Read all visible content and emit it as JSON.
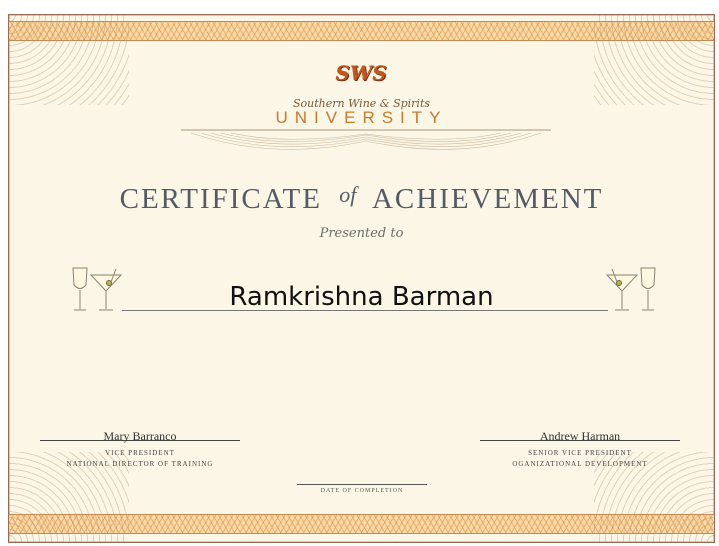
{
  "logo": {
    "monogram": "SWS",
    "subtitle": "Southern Wine & Spirits",
    "university": "UNIVERSITY"
  },
  "certificate": {
    "title_part1": "CERTIFICATE",
    "title_of": "of",
    "title_part2": "ACHIEVEMENT",
    "presented_to": "Presented to",
    "recipient": "Ramkrishna Barman",
    "date_label": "DATE OF COMPLETION"
  },
  "signatories": [
    {
      "name": "Mary Barranco",
      "role1": "VICE PRESIDENT",
      "role2": "NATIONAL DIRECTOR OF TRAINING"
    },
    {
      "name": "Andrew Harman",
      "role1": "SENIOR VICE PRESIDENT",
      "role2": "OGANIZATIONAL DEVELOPMENT"
    }
  ],
  "colors": {
    "background": "#fbf6e6",
    "border_band": "#f8d9a8",
    "accent": "#c57a2c",
    "title_text": "#555a66"
  },
  "icons": [
    "wine-glass-icon",
    "martini-glass-icon"
  ]
}
